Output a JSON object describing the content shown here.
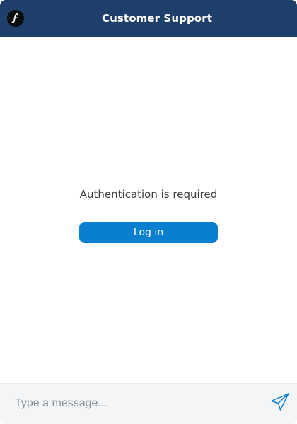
{
  "header": {
    "title": "Customer Support",
    "logo_icon": "brand-logo-icon",
    "background_color": "#1f3f6b"
  },
  "main": {
    "auth_message": "Authentication is required",
    "login_label": "Log in",
    "login_button_color": "#0a7fcf"
  },
  "composer": {
    "placeholder": "Type a message...",
    "send_icon": "send-icon"
  }
}
